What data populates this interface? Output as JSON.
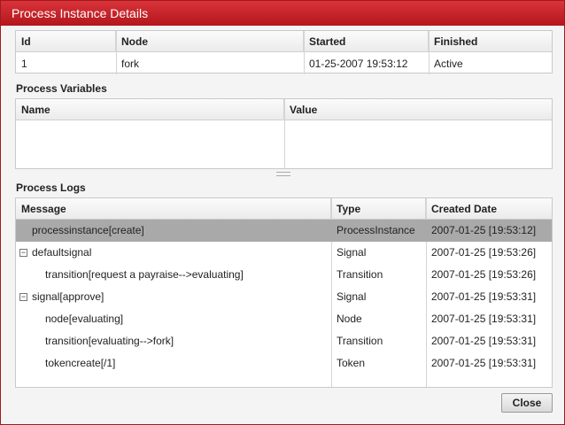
{
  "window": {
    "title": "Process Instance Details"
  },
  "instance": {
    "columns": [
      "Id",
      "Node",
      "Started",
      "Finished"
    ],
    "row": [
      "1",
      "fork",
      "01-25-2007 19:53:12",
      "Active"
    ]
  },
  "variables": {
    "label": "Process Variables",
    "columns": [
      "Name",
      "Value"
    ]
  },
  "logs": {
    "label": "Process Logs",
    "columns": [
      "Message",
      "Type",
      "Created Date"
    ],
    "rows": [
      {
        "message": "processinstance[create]",
        "type": "ProcessInstance",
        "date": "2007-01-25 [19:53:12]"
      },
      {
        "message": "defaultsignal",
        "type": "Signal",
        "date": "2007-01-25 [19:53:26]"
      },
      {
        "message": "transition[request a payraise-->evaluating]",
        "type": "Transition",
        "date": "2007-01-25 [19:53:26]"
      },
      {
        "message": "signal[approve]",
        "type": "Signal",
        "date": "2007-01-25 [19:53:31]"
      },
      {
        "message": "node[evaluating]",
        "type": "Node",
        "date": "2007-01-25 [19:53:31]"
      },
      {
        "message": "transition[evaluating-->fork]",
        "type": "Transition",
        "date": "2007-01-25 [19:53:31]"
      },
      {
        "message": "tokencreate[/1]",
        "type": "Token",
        "date": "2007-01-25 [19:53:31]"
      }
    ]
  },
  "buttons": {
    "close": "Close"
  }
}
